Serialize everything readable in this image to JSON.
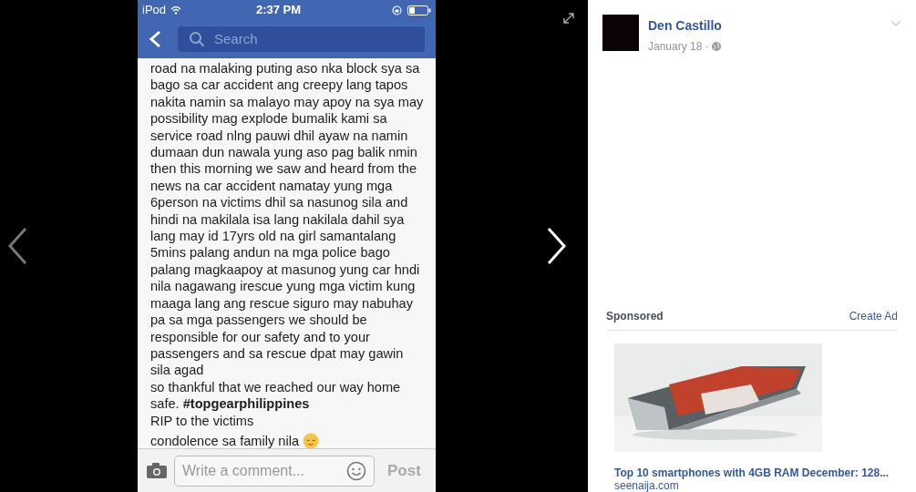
{
  "phone_screenshot": {
    "status_bar": {
      "carrier": "iPod",
      "time": "2:37 PM"
    },
    "search": {
      "placeholder": "Search"
    },
    "post_lines": [
      "road na malaking puting aso nka block sya sa",
      "bago sa car accident ang creepy lang tapos",
      "nakita namin sa malayo may apoy na sya may",
      "possibility mag explode bumalik kami sa",
      "service road nlng pauwi dhil ayaw na namin",
      "dumaan dun nawala yung aso pag balik nmin",
      "then this morning we saw and heard from the",
      "news na car accident namatay yung mga",
      "6person na victims dhil sa nasunog sila and",
      "hindi na makilala isa lang nakilala dahil sya",
      "lang may id 17yrs old na girl samantalang",
      "5mins palang andun na mga police bago",
      "palang magkaapoy at masunog yung car hndi",
      "nila nagawang irescue yung mga victim kung",
      "maaga lang ang rescue siguro may nabuhay",
      "pa sa mga passengers we should be",
      "responsible for our safety and to your",
      "passengers and sa rescue dpat may gawin",
      "sila agad",
      "so thankful that we reached our way home",
      "safe. **#topgearphilippines**",
      "RIP to the victims",
      "condolence sa family nila"
    ],
    "comment": {
      "placeholder": "Write a comment...",
      "post_button": "Post"
    }
  },
  "post": {
    "author": "Den Castillo",
    "date": "January 18 ·"
  },
  "sponsored": {
    "heading": "Sponsored",
    "create_ad": "Create Ad",
    "ad": {
      "title": "Top 10 smartphones with 4GB RAM December: 128...",
      "domain": "seenaija.com"
    }
  }
}
